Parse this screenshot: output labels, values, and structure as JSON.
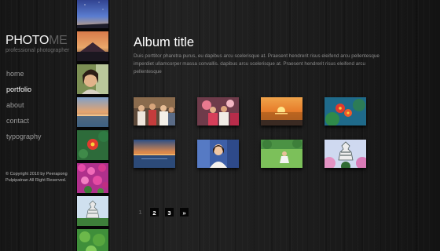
{
  "logo": {
    "part1": "PHOTO",
    "part2": "ME",
    "tagline": "professional photographer"
  },
  "nav": {
    "items": [
      "home",
      "portfolio",
      "about",
      "contact",
      "typography"
    ],
    "active": "portfolio"
  },
  "copyright": "© Copyright 2010 by Peerapong Pulpipatnan All Right Reserved.",
  "album": {
    "title": "Album title",
    "description": "Duis porttitor pharetra purus, eu dapibus arcu scelerisque at. Praesent hendrerit risus eleifend arcu pellentesque imperdiet ullamcorper massa convallis. dapibus arcu scelerisque at. Praesent hendrerit risus eleifend arcu pellentesque"
  },
  "photos": [
    "group of people",
    "people at party",
    "sunset over water",
    "red flowers",
    "sunset over sea",
    "woman portrait",
    "girl on grass",
    "castle with pink trees"
  ],
  "strip": [
    "twilight sky",
    "mountain at dusk",
    "smiling woman",
    "sea at sunset",
    "red flower",
    "pink flower field",
    "castle",
    "green leaves"
  ],
  "pagination": {
    "current": "1",
    "pages": [
      "2",
      "3"
    ],
    "next": "»"
  }
}
